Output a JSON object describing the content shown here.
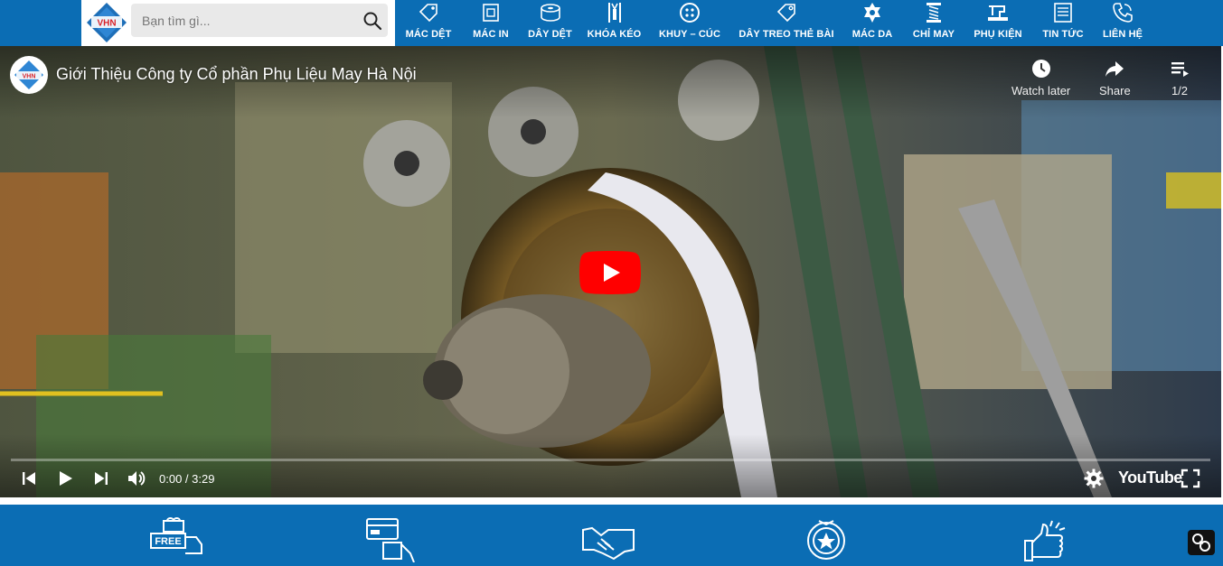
{
  "header": {
    "logo_text": "VHN",
    "search": {
      "placeholder": "Bạn tìm gì..."
    },
    "nav": [
      {
        "label": "MÁC DỆT",
        "icon": "tag-icon"
      },
      {
        "label": "MÁC IN",
        "icon": "printed-label-icon"
      },
      {
        "label": "DÂY DỆT",
        "icon": "ribbon-roll-icon"
      },
      {
        "label": "KHÓA KÉO",
        "icon": "zipper-icon"
      },
      {
        "label": "KHUY – CÚC",
        "icon": "button-icon"
      },
      {
        "label": "DÂY TREO THẺ BÀI",
        "icon": "hang-tag-icon"
      },
      {
        "label": "MÁC DA",
        "icon": "leather-badge-icon"
      },
      {
        "label": "CHỈ MAY",
        "icon": "thread-spool-icon"
      },
      {
        "label": "PHỤ KIỆN",
        "icon": "sewing-machine-icon"
      },
      {
        "label": "TIN TỨC",
        "icon": "news-icon"
      },
      {
        "label": "LIÊN HỆ",
        "icon": "phone-icon"
      }
    ]
  },
  "video": {
    "title": "Giới Thiệu Công ty Cổ phần Phụ Liệu May Hà Nội",
    "watch_later": "Watch later",
    "share": "Share",
    "playlist_position": "1/2",
    "time": "0:00 / 3:29",
    "youtube_label": "YouTube",
    "progress": 0
  },
  "features": {
    "free_label": "FREE",
    "icons": [
      "free-delivery-icon",
      "card-payment-icon",
      "handshake-icon",
      "quality-badge-icon",
      "thumbs-up-icon"
    ]
  },
  "colors": {
    "brand_blue": "#0b6db4",
    "youtube_red": "#ff0000"
  }
}
